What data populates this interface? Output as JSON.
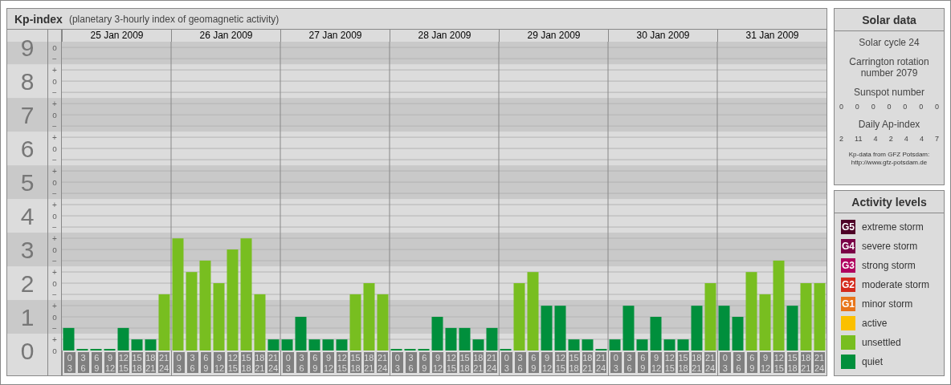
{
  "kp_panel": {
    "title": "Kp-index",
    "subtitle": "(planetary 3-hourly index of geomagnetic activity)",
    "dates": [
      "25 Jan 2009",
      "26 Jan 2009",
      "27 Jan 2009",
      "28 Jan 2009",
      "29 Jan 2009",
      "30 Jan 2009",
      "31 Jan 2009"
    ],
    "fine_ticks": [
      "o",
      "−",
      "+",
      "o",
      "−",
      "+",
      "o",
      "−",
      "+",
      "o",
      "−",
      "+",
      "o",
      "−",
      "+",
      "o",
      "−",
      "+",
      "o",
      "−",
      "+",
      "o",
      "−",
      "+",
      "o",
      "−",
      "+",
      "o"
    ],
    "chart_data": {
      "type": "bar",
      "stacked": true,
      "grid": true,
      "ylim": [
        0,
        9.17
      ],
      "bands": [
        {
          "axis": "y",
          "from": 8.5,
          "to": 9.5
        },
        {
          "axis": "y",
          "from": 6.5,
          "to": 7.5
        },
        {
          "axis": "y",
          "from": 4.5,
          "to": 5.5
        },
        {
          "axis": "y",
          "from": 2.5,
          "to": 3.5
        },
        {
          "axis": "y",
          "from": 0.5,
          "to": 1.5
        }
      ],
      "yticks": [
        {
          "value": 9,
          "label": "9"
        },
        {
          "value": 8,
          "label": "8"
        },
        {
          "value": 7,
          "label": "7"
        },
        {
          "value": 6,
          "label": "6"
        },
        {
          "value": 5,
          "label": "5"
        },
        {
          "value": 4,
          "label": "4"
        },
        {
          "value": 3,
          "label": "3"
        },
        {
          "value": 2,
          "label": "2"
        },
        {
          "value": 1,
          "label": "1"
        },
        {
          "value": 0,
          "label": "0"
        }
      ],
      "categories": [
        "0 3",
        "3 6",
        "6 9",
        "9 12",
        "12 15",
        "15 18",
        "18 21",
        "21 24",
        "0 3",
        "3 6",
        "6 9",
        "9 12",
        "12 15",
        "15 18",
        "18 21",
        "21 24",
        "0 3",
        "3 6",
        "6 9",
        "9 12",
        "12 15",
        "15 18",
        "18 21",
        "21 24",
        "0 3",
        "3 6",
        "6 9",
        "9 12",
        "12 15",
        "15 18",
        "18 21",
        "21 24",
        "0 3",
        "3 6",
        "6 9",
        "9 12",
        "12 15",
        "15 18",
        "18 21",
        "21 24",
        "0 3",
        "3 6",
        "6 9",
        "9 12",
        "12 15",
        "15 18",
        "18 21",
        "21 24",
        "0 3",
        "3 6",
        "6 9",
        "9 12",
        "12 15",
        "15 18",
        "18 21",
        "21 24"
      ],
      "series": [
        {
          "color": "#008f3c",
          "values": [
            0.67,
            0,
            0,
            0,
            0.67,
            0.33,
            0.33,
            null,
            null,
            null,
            null,
            null,
            null,
            null,
            null,
            0.33,
            0.33,
            1,
            0.33,
            0.33,
            0.33,
            null,
            null,
            null,
            0,
            0,
            0,
            1,
            0.67,
            0.67,
            0.33,
            0.67,
            0,
            null,
            null,
            1.33,
            1.33,
            0.33,
            0.33,
            0,
            0.33,
            1.33,
            0.33,
            1,
            0.33,
            0.33,
            1.33,
            null,
            1.33,
            1,
            null,
            null,
            null,
            1.33,
            null,
            null
          ]
        },
        {
          "color": "#78be20",
          "values": [
            null,
            null,
            null,
            null,
            null,
            null,
            null,
            1.67,
            3.33,
            2.33,
            2.67,
            2,
            3,
            3.33,
            1.67,
            null,
            null,
            null,
            null,
            null,
            null,
            1.67,
            2,
            1.67,
            null,
            null,
            null,
            null,
            null,
            null,
            null,
            null,
            null,
            2,
            2.33,
            null,
            null,
            null,
            null,
            null,
            null,
            null,
            null,
            null,
            null,
            null,
            null,
            2,
            null,
            null,
            2.33,
            1.67,
            2.67,
            null,
            2,
            2
          ]
        }
      ]
    }
  },
  "solar_data": {
    "title": "Solar data",
    "solar_cycle": "Solar cycle 24",
    "carrington": "Carrington rotation number 2079",
    "sunspot_label": "Sunspot number",
    "sunspot_numbers": [
      "0",
      "0",
      "0",
      "0",
      "0",
      "0",
      "0"
    ],
    "ap_label": "Daily Ap-index",
    "ap_values": [
      "2",
      "11",
      "4",
      "2",
      "4",
      "4",
      "7"
    ],
    "source": "Kp-data from GFZ Potsdam:",
    "source_url": "http://www.gfz-potsdam.de"
  },
  "activity_levels": {
    "title": "Activity levels",
    "items": [
      {
        "badge": "G5",
        "label": "extreme storm",
        "color": "#4d0026"
      },
      {
        "badge": "G4",
        "label": "severe storm",
        "color": "#7a0047"
      },
      {
        "badge": "G3",
        "label": "strong storm",
        "color": "#b0005f"
      },
      {
        "badge": "G2",
        "label": "moderate storm",
        "color": "#d42a1c"
      },
      {
        "badge": "G1",
        "label": "minor storm",
        "color": "#e8751a"
      },
      {
        "label": "active",
        "color": "#fbc000"
      },
      {
        "label": "unsettled",
        "color": "#78be20"
      },
      {
        "label": "quiet",
        "color": "#008f3c"
      }
    ]
  }
}
